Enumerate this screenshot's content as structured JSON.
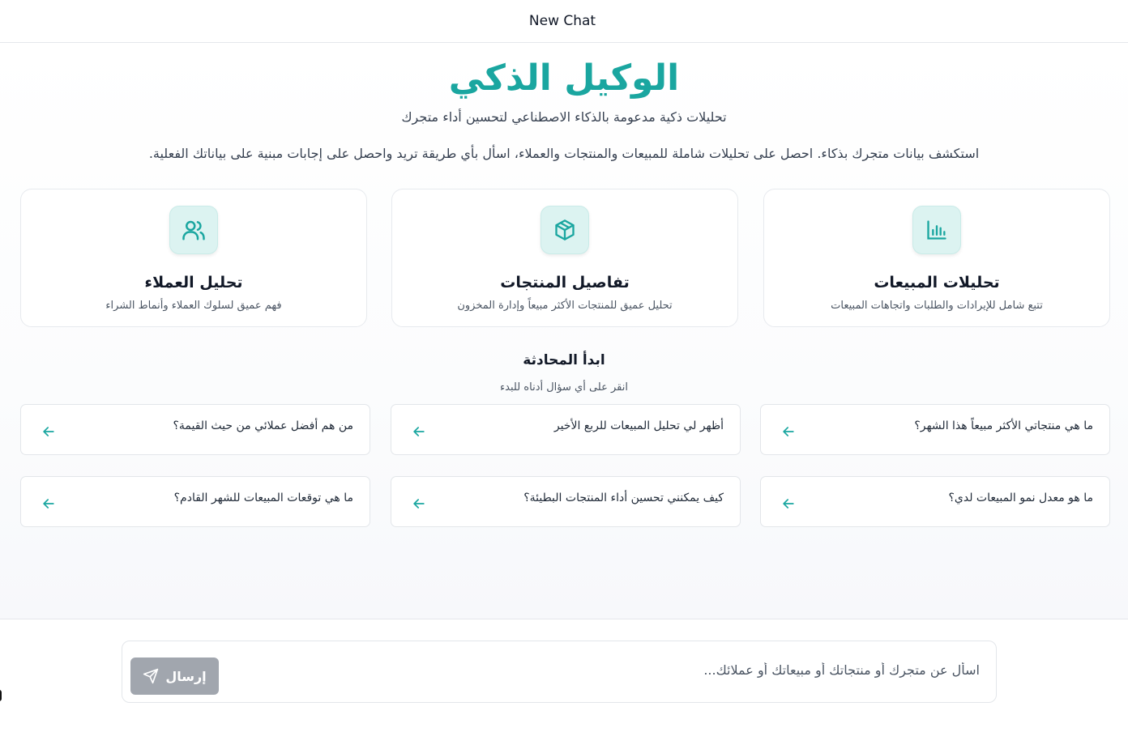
{
  "header": {
    "title": "New Chat"
  },
  "hero": {
    "title": "الوكيل الذكي",
    "subtitle": "تحليلات ذكية مدعومة بالذكاء الاصطناعي لتحسين أداء متجرك",
    "intro": "استكشف بيانات متجرك بذكاء. احصل على تحليلات شاملة للمبيعات والمنتجات والعملاء، اسأل بأي طريقة تريد واحصل على إجابات مبنية على بياناتك الفعلية."
  },
  "features": [
    {
      "icon": "bar-chart-icon",
      "title": "تحليلات المبيعات",
      "desc": "تتبع شامل للإيرادات والطلبات واتجاهات المبيعات"
    },
    {
      "icon": "box-icon",
      "title": "تفاصيل المنتجات",
      "desc": "تحليل عميق للمنتجات الأكثر مبيعاً وإدارة المخزون"
    },
    {
      "icon": "users-icon",
      "title": "تحليل العملاء",
      "desc": "فهم عميق لسلوك العملاء وأنماط الشراء"
    }
  ],
  "start": {
    "title": "ابدأ المحادثة",
    "subtitle": "انقر على أي سؤال أدناه للبدء"
  },
  "questions": [
    "ما هي منتجاتي الأكثر مبيعاً هذا الشهر؟",
    "أظهر لي تحليل المبيعات للربع الأخير",
    "من هم أفضل عملائي من حيث القيمة؟",
    "ما هو معدل نمو المبيعات لدي؟",
    "كيف يمكنني تحسين أداء المنتجات البطيئة؟",
    "ما هي توقعات المبيعات للشهر القادم؟"
  ],
  "composer": {
    "placeholder": "اسأل عن متجرك أو منتجاتك أو مبيعاتك أو عملائك...",
    "send_label": "إرسال",
    "send_icon": "send-icon"
  },
  "colors": {
    "accent": "#1aa6a0",
    "icon_bg": "#dcf3f1",
    "send_disabled": "#a1a6ae"
  }
}
